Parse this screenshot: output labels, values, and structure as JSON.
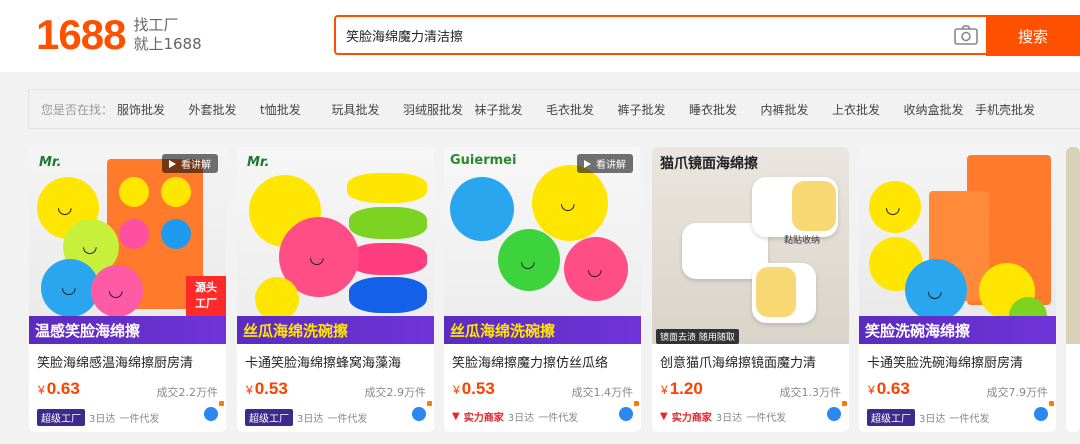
{
  "header": {
    "logo_number": "1688",
    "logo_slogan_line1": "找工厂",
    "logo_slogan_line2": "就上1688",
    "search_value": "笑脸海绵魔力清洁擦",
    "search_button": "搜索",
    "camera_icon": "camera-icon"
  },
  "suggestions": {
    "label": "您是否在找：",
    "items": [
      "服饰批发",
      "外套批发",
      "t恤批发",
      "玩具批发",
      "羽绒服批发",
      "袜子批发",
      "毛衣批发",
      "裤子批发",
      "睡衣批发",
      "内裤批发",
      "上衣批发",
      "收纳盒批发",
      "手机壳批发"
    ]
  },
  "products": [
    {
      "brand": "Mr.",
      "video_label": "看讲解",
      "banner_text": "温感笑脸海绵擦",
      "corner_text": "源头工厂",
      "title": "笑脸海绵感温海绵擦厨房清",
      "currency": "¥",
      "price": "0.63",
      "sold": "成交2.2万件",
      "badge": "超级工厂",
      "delivery": "3日达",
      "service": "一件代发"
    },
    {
      "brand": "Mr.",
      "video_label": "",
      "banner_text": "丝瓜海绵洗碗擦",
      "title": "卡通笑脸海绵擦蜂窝海藻海",
      "currency": "¥",
      "price": "0.53",
      "sold": "成交2.9万件",
      "badge": "超级工厂",
      "delivery": "3日达",
      "service": "一件代发"
    },
    {
      "brand": "Guiermei",
      "video_label": "看讲解",
      "banner_text": "丝瓜海绵洗碗擦",
      "title": "笑脸海绵擦魔力擦仿丝瓜络",
      "currency": "¥",
      "price": "0.53",
      "sold": "成交1.4万件",
      "badge": "实力商家",
      "delivery": "3日达",
      "service": "一件代发"
    },
    {
      "brand": "",
      "video_label": "",
      "banner_text": "猫爪镜面海绵擦",
      "sub_tag": "镜面去渍 随用随取",
      "sticker": "黏贴收纳",
      "title": "创意猫爪海绵擦镜面魔力清",
      "currency": "¥",
      "price": "1.20",
      "sold": "成交1.3万件",
      "badge": "实力商家",
      "delivery": "3日达",
      "service": "一件代发"
    },
    {
      "brand": "",
      "video_label": "",
      "banner_text": "笑脸洗碗海绵擦",
      "title": "卡通笑脸洗碗海绵擦厨房清",
      "currency": "¥",
      "price": "0.63",
      "sold": "成交7.9万件",
      "badge": "超级工厂",
      "delivery": "3日达",
      "service": "一件代发"
    }
  ],
  "colors": {
    "brand_orange": "#ff5000",
    "price_red": "#ff4000",
    "banner_purple": "#6f34d9",
    "badge_super": "#3c2a8c",
    "badge_strong": "#e0262b"
  }
}
